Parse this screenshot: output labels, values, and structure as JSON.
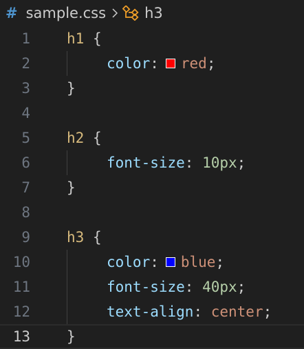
{
  "breadcrumb": {
    "file_icon": "#",
    "file_name": "sample.css",
    "symbol": "h3"
  },
  "editor": {
    "line_numbers": [
      "1",
      "2",
      "3",
      "4",
      "5",
      "6",
      "7",
      "8",
      "9",
      "10",
      "11",
      "12",
      "13"
    ],
    "current_line": "13",
    "code": {
      "l1_selector": "h1",
      "l1_brace": " {",
      "l2_prop": "color",
      "l2_colon": ":",
      "l2_value": "red",
      "l2_semi": ";",
      "l3_brace": "}",
      "l5_selector": "h2",
      "l5_brace": " {",
      "l6_prop": "font-size",
      "l6_colon": ": ",
      "l6_value": "10px",
      "l6_semi": ";",
      "l7_brace": "}",
      "l9_selector": "h3",
      "l9_brace": " {",
      "l10_prop": "color",
      "l10_colon": ":",
      "l10_value": "blue",
      "l10_semi": ";",
      "l11_prop": "font-size",
      "l11_colon": ": ",
      "l11_value": "40px",
      "l11_semi": ";",
      "l12_prop": "text-align",
      "l12_colon": ": ",
      "l12_value": "center",
      "l12_semi": ";",
      "l13_brace": "}"
    },
    "swatches": {
      "red": "#ff0000",
      "blue": "#0000ff"
    }
  },
  "colors": {
    "background": "#1f1f1f",
    "selector": "#d7ba7d",
    "property": "#9cdcfe",
    "value": "#ce9178",
    "number": "#b5cea8"
  },
  "icons": {
    "file": "css-hash-icon",
    "separator": "chevron-right-icon",
    "symbol": "symbol-class-icon"
  }
}
